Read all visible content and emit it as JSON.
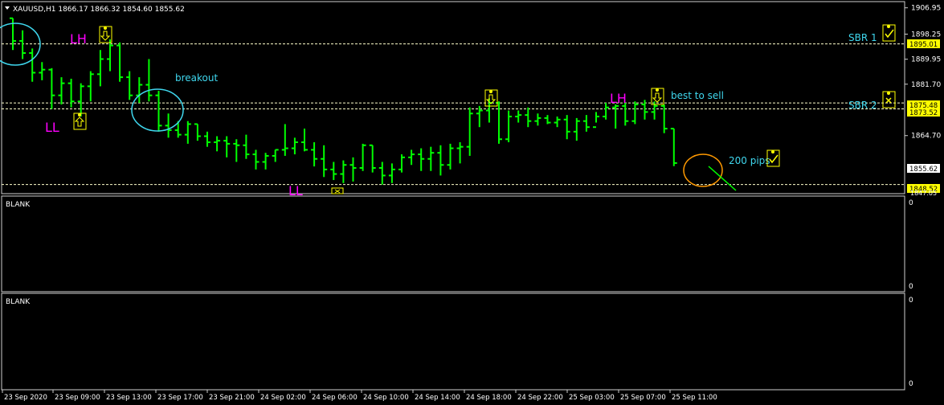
{
  "window": {
    "symbol_header": "XAUUSD,H1  1866.17 1866.32 1854.60 1855.62"
  },
  "colors": {
    "background": "#000000",
    "bars": "#00ff00",
    "grid_line": "#ffffcc",
    "axis_text": "#ffffff",
    "annotation_cyan": "#3fd7ee",
    "annotation_magenta": "#ff00ff",
    "circle_cyan": "#3fd7ee",
    "circle_orange": "#ff9900",
    "price_tag_yellow": "#ffff00",
    "current_price_tag": "#ffffff"
  },
  "price_axis": {
    "ticks": [
      "1906.95",
      "1898.25",
      "1889.95",
      "1881.70",
      "1864.70"
    ],
    "tags": [
      {
        "label": "1895.01",
        "style": "yellow"
      },
      {
        "label": "1875.48",
        "style": "yellow"
      },
      {
        "label": "1873.52",
        "style": "yellow"
      },
      {
        "label": "1855.62",
        "style": "white"
      },
      {
        "label": "1848.52",
        "style": "yellow"
      },
      {
        "label": "1847.05",
        "style": "partial"
      }
    ]
  },
  "time_axis": {
    "labels": [
      "23 Sep 2020",
      "23 Sep 09:00",
      "23 Sep 13:00",
      "23 Sep 17:00",
      "23 Sep 21:00",
      "24 Sep 02:00",
      "24 Sep 06:00",
      "24 Sep 10:00",
      "24 Sep 14:00",
      "24 Sep 18:00",
      "24 Sep 22:00",
      "25 Sep 03:00",
      "25 Sep 07:00",
      "25 Sep 11:00"
    ]
  },
  "subwindows": [
    {
      "title": "BLANK",
      "top_label": "0",
      "bottom_label": "0"
    },
    {
      "title": "BLANK",
      "top_label": "0",
      "bottom_label": "0"
    }
  ],
  "annotations": {
    "lh_left": "LH",
    "ll_left": "LL",
    "ll_bottom": "LL",
    "lh_right": "LH",
    "breakout": "breakout",
    "best_to_sell": "best to sell",
    "pips": "200 pips",
    "sbr1": "SBR 1",
    "sbr2": "SBR 2"
  },
  "chart_data": {
    "type": "bar",
    "title": "XAUUSD,H1  1866.17 1866.32 1854.60 1855.62",
    "ylim": [
      1845.5,
      1909.0
    ],
    "levels": [
      1895.01,
      1873.52,
      1848.52
    ],
    "ohlc": [
      [
        1903.5,
        1903.5,
        1893.0,
        1896.0
      ],
      [
        1896.0,
        1899.5,
        1890.0,
        1892.0
      ],
      [
        1892.0,
        1893.5,
        1882.5,
        1885.5
      ],
      [
        1885.5,
        1889.0,
        1883.0,
        1886.5
      ],
      [
        1886.5,
        1887.0,
        1873.5,
        1878.0
      ],
      [
        1878.0,
        1884.0,
        1875.0,
        1882.0
      ],
      [
        1882.0,
        1883.5,
        1874.0,
        1876.0
      ],
      [
        1876.0,
        1882.0,
        1871.0,
        1881.0
      ],
      [
        1881.0,
        1886.0,
        1876.0,
        1885.0
      ],
      [
        1885.0,
        1893.0,
        1881.0,
        1890.0
      ],
      [
        1890.0,
        1896.5,
        1886.0,
        1894.5
      ],
      [
        1894.5,
        1895.5,
        1882.5,
        1884.0
      ],
      [
        1884.0,
        1886.0,
        1876.5,
        1878.0
      ],
      [
        1878.0,
        1884.0,
        1875.5,
        1881.5
      ],
      [
        1881.5,
        1890.0,
        1876.0,
        1878.0
      ],
      [
        1878.0,
        1879.5,
        1866.0,
        1868.0
      ],
      [
        1868.0,
        1872.0,
        1864.0,
        1866.5
      ],
      [
        1866.5,
        1869.5,
        1864.0,
        1865.0
      ],
      [
        1865.0,
        1869.5,
        1862.0,
        1868.5
      ],
      [
        1868.5,
        1868.5,
        1863.0,
        1864.5
      ],
      [
        1864.5,
        1866.0,
        1861.0,
        1862.5
      ],
      [
        1862.5,
        1864.5,
        1859.5,
        1863.0
      ],
      [
        1863.0,
        1864.5,
        1857.5,
        1862.0
      ],
      [
        1862.0,
        1863.5,
        1856.0,
        1861.5
      ],
      [
        1861.5,
        1865.0,
        1857.0,
        1858.5
      ],
      [
        1858.5,
        1860.0,
        1853.5,
        1856.0
      ],
      [
        1856.0,
        1859.0,
        1853.5,
        1858.0
      ],
      [
        1858.0,
        1860.0,
        1856.0,
        1860.0
      ],
      [
        1860.0,
        1868.5,
        1858.0,
        1860.5
      ],
      [
        1860.5,
        1864.0,
        1858.5,
        1862.5
      ],
      [
        1862.5,
        1867.0,
        1859.5,
        1860.0
      ],
      [
        1860.0,
        1862.5,
        1854.5,
        1857.0
      ],
      [
        1857.0,
        1861.5,
        1851.0,
        1853.5
      ],
      [
        1853.5,
        1856.0,
        1850.0,
        1852.0
      ],
      [
        1852.0,
        1856.5,
        1849.0,
        1855.0
      ],
      [
        1855.0,
        1857.5,
        1849.5,
        1854.0
      ],
      [
        1854.0,
        1862.0,
        1853.0,
        1861.5
      ],
      [
        1861.5,
        1861.5,
        1852.5,
        1854.0
      ],
      [
        1854.0,
        1856.0,
        1848.5,
        1851.5
      ],
      [
        1851.5,
        1855.5,
        1849.0,
        1853.5
      ],
      [
        1853.5,
        1858.5,
        1852.5,
        1857.5
      ],
      [
        1857.5,
        1860.0,
        1855.0,
        1858.5
      ],
      [
        1858.5,
        1860.5,
        1853.0,
        1857.0
      ],
      [
        1857.0,
        1861.0,
        1853.0,
        1859.0
      ],
      [
        1859.0,
        1861.5,
        1851.5,
        1855.0
      ],
      [
        1855.0,
        1862.0,
        1853.5,
        1860.5
      ],
      [
        1860.5,
        1862.5,
        1855.5,
        1861.0
      ],
      [
        1861.0,
        1874.0,
        1858.0,
        1872.0
      ],
      [
        1872.0,
        1874.5,
        1867.5,
        1873.0
      ],
      [
        1873.0,
        1877.0,
        1869.0,
        1875.5
      ],
      [
        1875.5,
        1876.0,
        1862.0,
        1863.5
      ],
      [
        1863.5,
        1873.0,
        1862.5,
        1871.0
      ],
      [
        1871.0,
        1873.0,
        1869.0,
        1871.5
      ],
      [
        1871.5,
        1874.0,
        1867.5,
        1869.5
      ],
      [
        1869.5,
        1872.0,
        1868.0,
        1870.5
      ],
      [
        1870.5,
        1871.5,
        1868.5,
        1869.0
      ],
      [
        1869.0,
        1871.0,
        1867.5,
        1870.0
      ],
      [
        1870.0,
        1871.5,
        1863.5,
        1866.0
      ],
      [
        1866.0,
        1870.5,
        1863.0,
        1869.5
      ],
      [
        1869.5,
        1871.5,
        1866.0,
        1867.5
      ],
      [
        1867.5,
        1872.5,
        1869.0,
        1871.0
      ],
      [
        1871.0,
        1875.5,
        1870.0,
        1874.0
      ],
      [
        1874.0,
        1875.0,
        1867.0,
        1874.5
      ],
      [
        1874.5,
        1875.5,
        1868.0,
        1869.5
      ],
      [
        1869.5,
        1876.0,
        1868.5,
        1875.0
      ],
      [
        1875.0,
        1876.5,
        1870.0,
        1872.5
      ],
      [
        1872.5,
        1876.0,
        1870.0,
        1874.5
      ],
      [
        1874.5,
        1875.0,
        1865.5,
        1867.0
      ],
      [
        1867.0,
        1867.0,
        1854.6,
        1855.62
      ]
    ]
  }
}
